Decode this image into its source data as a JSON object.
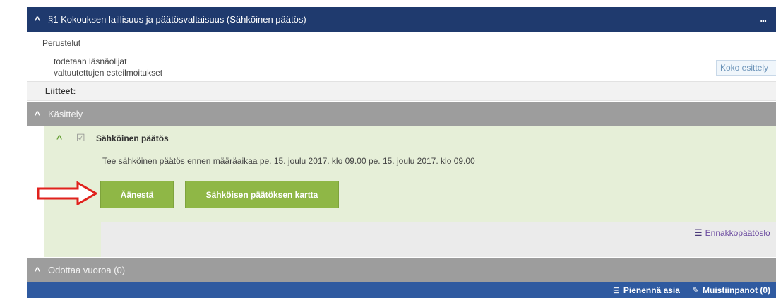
{
  "header": {
    "title": "§1 Kokouksen laillisuus ja päätösvaltaisuus (Sähköinen päätös)",
    "more_label": "...",
    "collapse_icon": "chevron-up-icon"
  },
  "perustelut": {
    "label": "Perustelut",
    "items": [
      "todetaan läsnäolijat",
      "valtuutettujen esteilmoitukset"
    ],
    "koko_esittely": "Koko esittely"
  },
  "liitteet": {
    "label": "Liitteet:"
  },
  "kasittely": {
    "label": "Käsittely",
    "item": {
      "label": "Sähköinen päätös",
      "deadline_text": "Tee sähköinen päätös ennen määräaikaa pe. 15. joulu 2017. klo 09.00 pe. 15. joulu 2017. klo 09.00",
      "vote_button": "Äänestä",
      "map_button": "Sähköisen päätöksen kartta",
      "ennakko_label": "Ennakkopäätöslo"
    }
  },
  "odottaa": {
    "label": "Odottaa vuoroa (0)"
  },
  "footer": {
    "pienenna_label": "Pienennä asia",
    "muistiinpanot_label": "Muistiinpanot  (0)"
  },
  "colors": {
    "header_bg": "#1f3a6e",
    "section_bg": "#9d9d9d",
    "panel_bg": "#e6efd8",
    "button_green": "#8fb746",
    "footer_bg": "#2f5aa0",
    "arrow_red": "#e0221d"
  }
}
